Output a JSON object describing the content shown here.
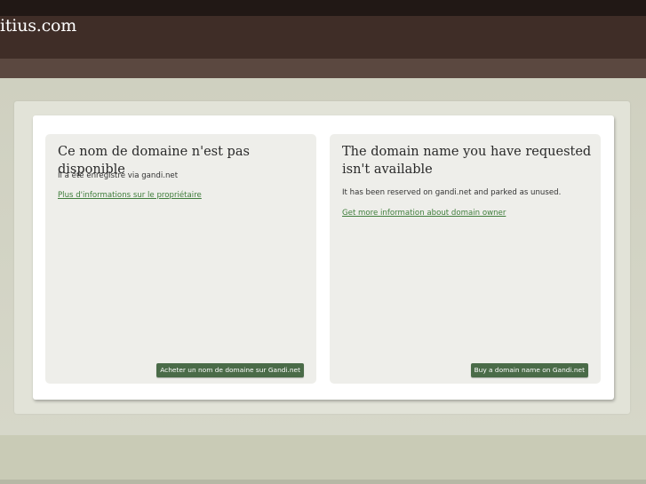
{
  "header": {
    "site_title": "itius.com"
  },
  "french": {
    "title": "Ce nom de domaine n'est pas disponible",
    "text": "Il a été enregistré via gandi.net",
    "link": "Plus d'informations sur le propriétaire",
    "button": "Acheter un nom de domaine sur Gandi.net"
  },
  "english": {
    "title": "The domain name you have requested isn't available",
    "text": "It has been reserved on gandi.net and parked as unused.",
    "link": "Get more information about domain owner",
    "button": "Buy a domain name on Gandi.net"
  },
  "colors": {
    "header_dark": "#211815",
    "header_brown": "#3f2d27",
    "link_green": "#3f7d3b",
    "button_green": "#4a6b48"
  }
}
